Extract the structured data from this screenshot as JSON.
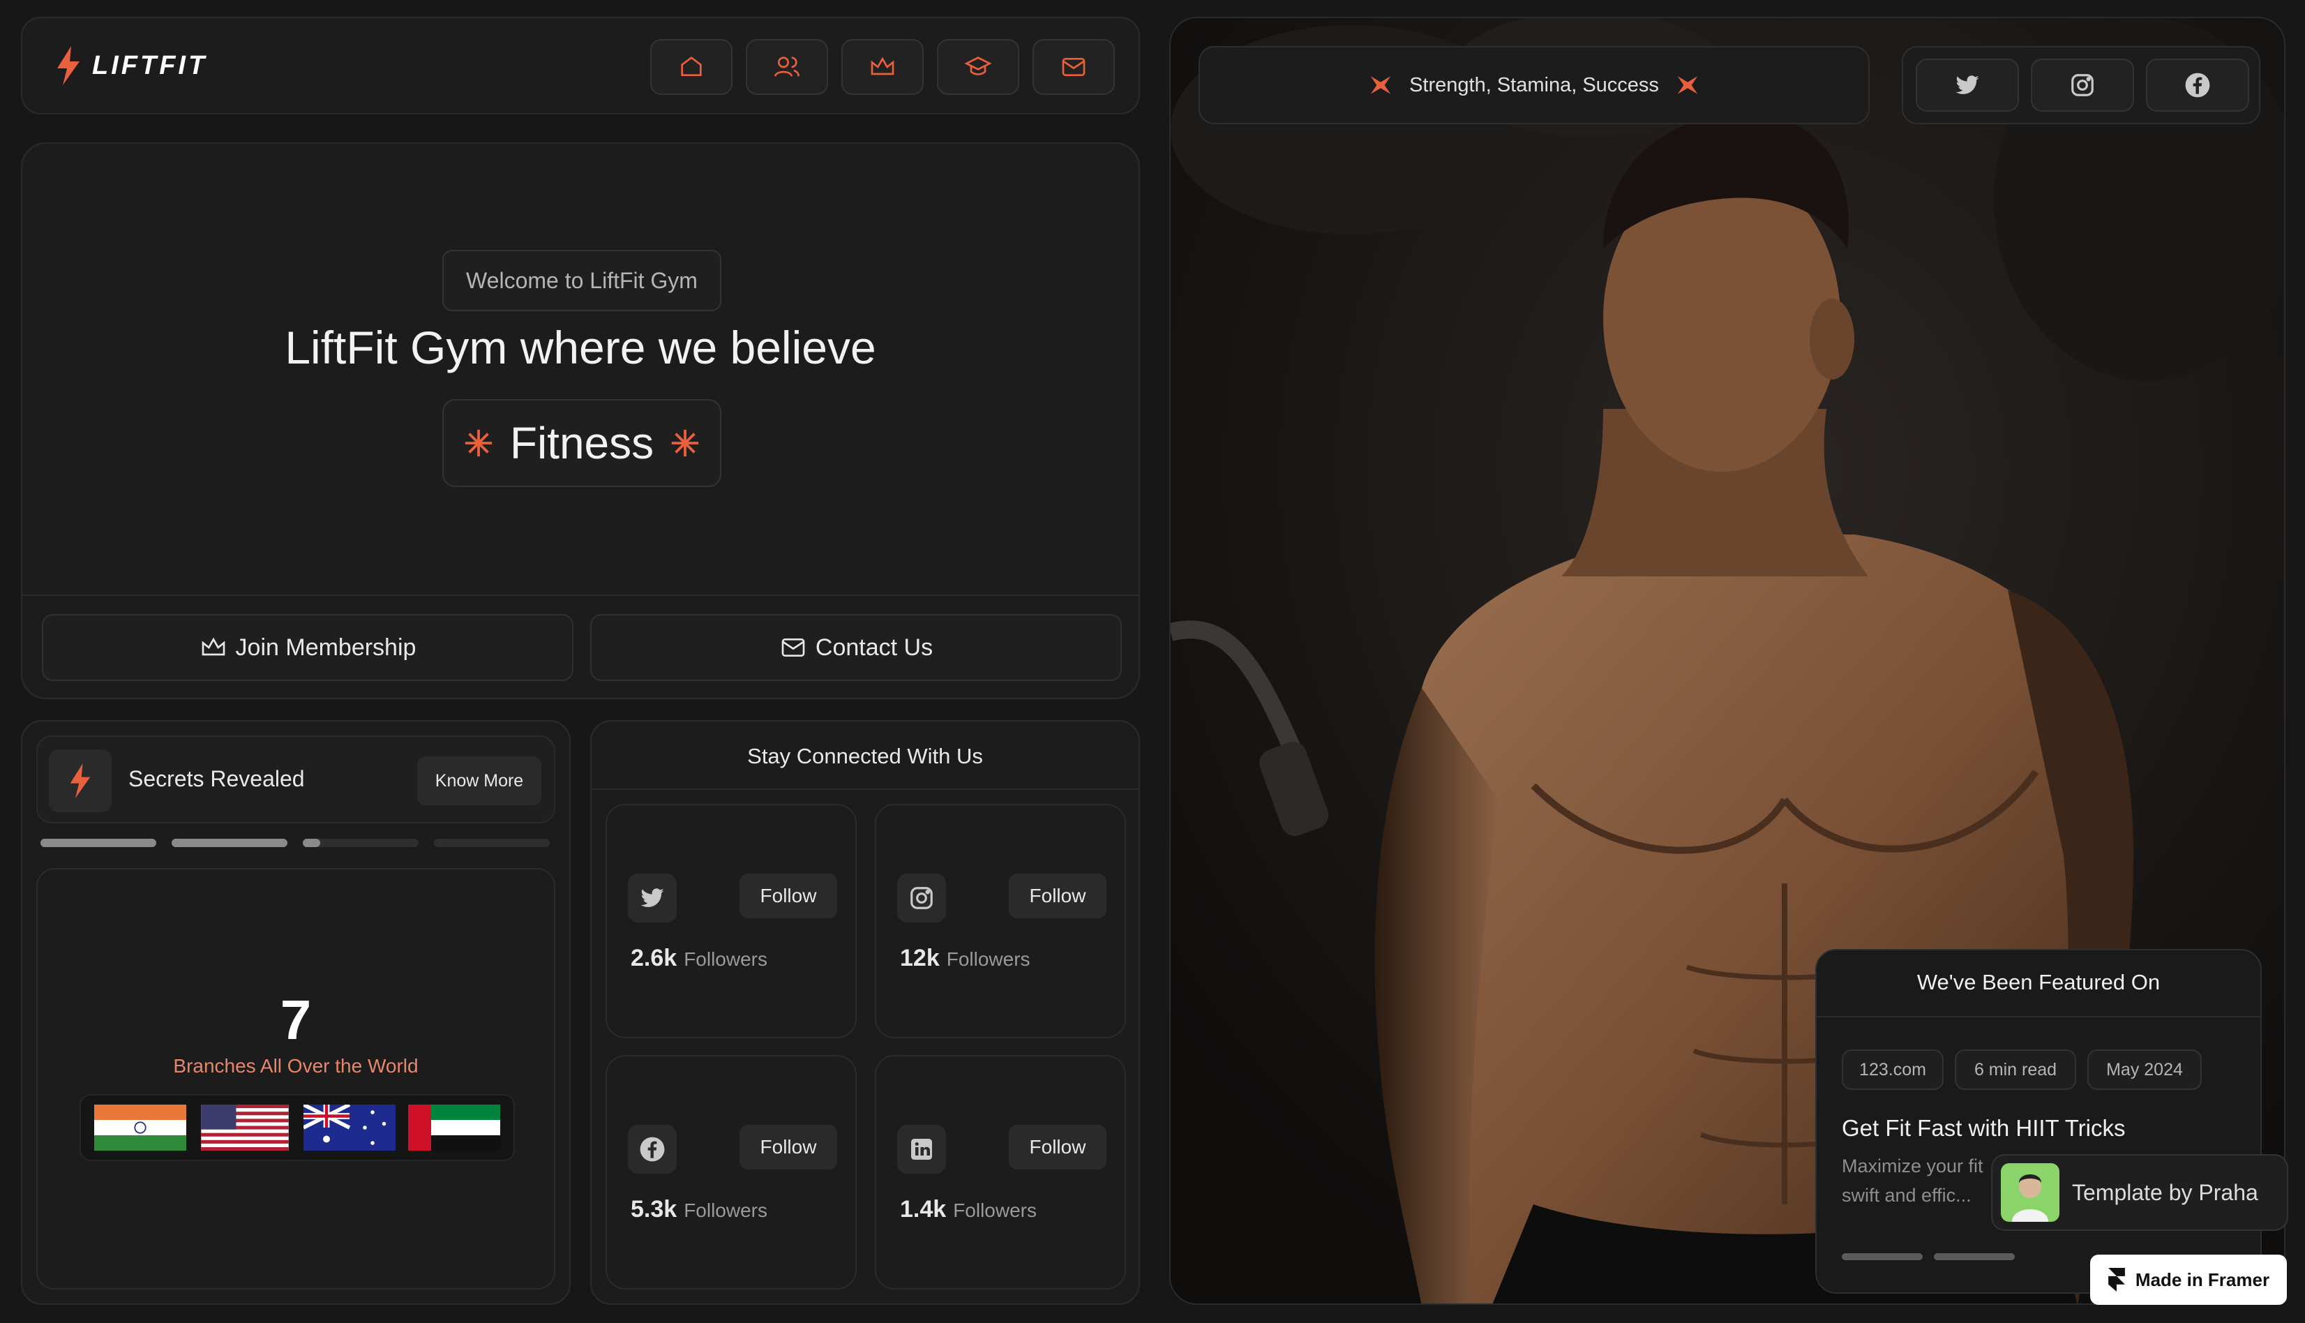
{
  "header": {
    "logo_text": "LIFTFIT",
    "nav_icons": [
      "home-icon",
      "users-icon",
      "crown-icon",
      "graduation-cap-icon",
      "mail-icon"
    ]
  },
  "hero": {
    "badge": "Welcome to LiftFit Gym",
    "headline": "LiftFit Gym where we believe",
    "highlight": "Fitness",
    "join_label": "Join Membership",
    "contact_label": "Contact Us"
  },
  "secrets": {
    "title": "Secrets Revealed",
    "button": "Know More",
    "progress": [
      1.0,
      1.0,
      0.15,
      0.0
    ]
  },
  "branches": {
    "count": "7",
    "label": "Branches All Over the World",
    "flags": [
      "india",
      "usa",
      "australia",
      "uae"
    ]
  },
  "social": {
    "title": "Stay Connected With Us",
    "follow_label": "Follow",
    "followers_label": "Followers",
    "cards": [
      {
        "network": "twitter-icon",
        "count": "2.6k"
      },
      {
        "network": "instagram-icon",
        "count": "12k"
      },
      {
        "network": "facebook-icon",
        "count": "5.3k"
      },
      {
        "network": "linkedin-icon",
        "count": "1.4k"
      }
    ]
  },
  "photo_panel": {
    "tagline": "Strength, Stamina, Success",
    "social_icons": [
      "twitter-icon",
      "instagram-icon",
      "facebook-icon"
    ]
  },
  "featured": {
    "title": "We've Been Featured On",
    "tags": [
      "123.com",
      "6 min read",
      "May 2024"
    ],
    "article_title": "Get Fit Fast with HIIT Tricks",
    "article_excerpt_line1": "Maximize your fit",
    "article_excerpt_line2": "swift and effic..."
  },
  "badges": {
    "template_by": "Template by Praha",
    "made_in": "Made in Framer"
  },
  "colors": {
    "accent": "#e8603c",
    "background": "#171717",
    "card": "#1c1c1c"
  }
}
